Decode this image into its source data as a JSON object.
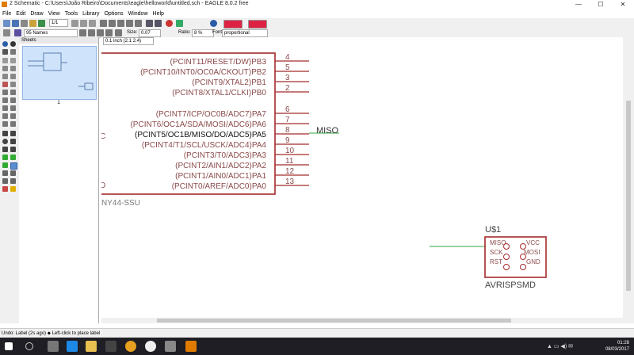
{
  "window": {
    "title": "2 Schematic - C:\\Users\\João Ribeiro\\Documents\\eagle\\helloworld\\untitled.sch - EAGLE 8.0.2 free",
    "minimize": "—",
    "maximize": "☐",
    "close": "✕"
  },
  "menu": [
    "File",
    "Edit",
    "Draw",
    "View",
    "Tools",
    "Library",
    "Options",
    "Window",
    "Help"
  ],
  "toolbar": {
    "sheet_select": "1/1",
    "layer_select": "95 Names",
    "size_label": "Size:",
    "size_value": "0.07",
    "ratio_label": "Ratio:",
    "ratio_value": "8 %",
    "font_label": "Font:",
    "font_value": "proportional"
  },
  "sheets_panel": {
    "header": "Sheets",
    "sheet_number": "1"
  },
  "canvas": {
    "coord_readout": "0.1 inch (2.1 2.4)",
    "chip": {
      "name_fragment": "NY44-SSU",
      "left_fragment_c": "C",
      "left_fragment_d": "D",
      "pins": [
        {
          "label": "(PCINT11/RESET/DW)PB3",
          "num": "4"
        },
        {
          "label": "(PCINT10/INT0/OC0A/CKOUT)PB2",
          "num": "5"
        },
        {
          "label": "(PCINT9/XTAL2)PB1",
          "num": "3"
        },
        {
          "label": "(PCINT8/XTAL1/CLKI)PB0",
          "num": "2"
        },
        {
          "label": "(PCINT7/ICP/OC0B/ADC7)PA7",
          "num": "6"
        },
        {
          "label": "(PCINT6/OC1A/SDA/MOSI/ADC6)PA6",
          "num": "7"
        },
        {
          "label": "(PCINT5/OC1B/MISO/DO/ADC5)PA5",
          "num": "8"
        },
        {
          "label": "(PCINT4/T1/SCL/USCK/ADC4)PA4",
          "num": "9"
        },
        {
          "label": "(PCINT3/T0/ADC3)PA3",
          "num": "10"
        },
        {
          "label": "(PCINT2/AIN1/ADC2)PA2",
          "num": "11"
        },
        {
          "label": "(PCINT1/AIN0/ADC1)PA1",
          "num": "12"
        },
        {
          "label": "(PCINT0/AREF/ADC0)PA0",
          "num": "13"
        }
      ]
    },
    "net_label": "MISO",
    "header": {
      "name": "U$1",
      "value": "AVRISPSMD",
      "left_pins": [
        "MISO",
        "SCK",
        "RST"
      ],
      "right_pins": [
        "VCC",
        "MOSI",
        "GND"
      ]
    }
  },
  "status": {
    "text": "Undo: Label (2s ago) ⬥ Left-click to place label"
  },
  "taskbar": {
    "time": "01:28",
    "date": "08/03/2017"
  },
  "colors": {
    "chip_outline": "#a52a2a",
    "pin_label": "#8b4a4a",
    "net": "#2faa3a",
    "header_outline": "#a52a2a"
  }
}
